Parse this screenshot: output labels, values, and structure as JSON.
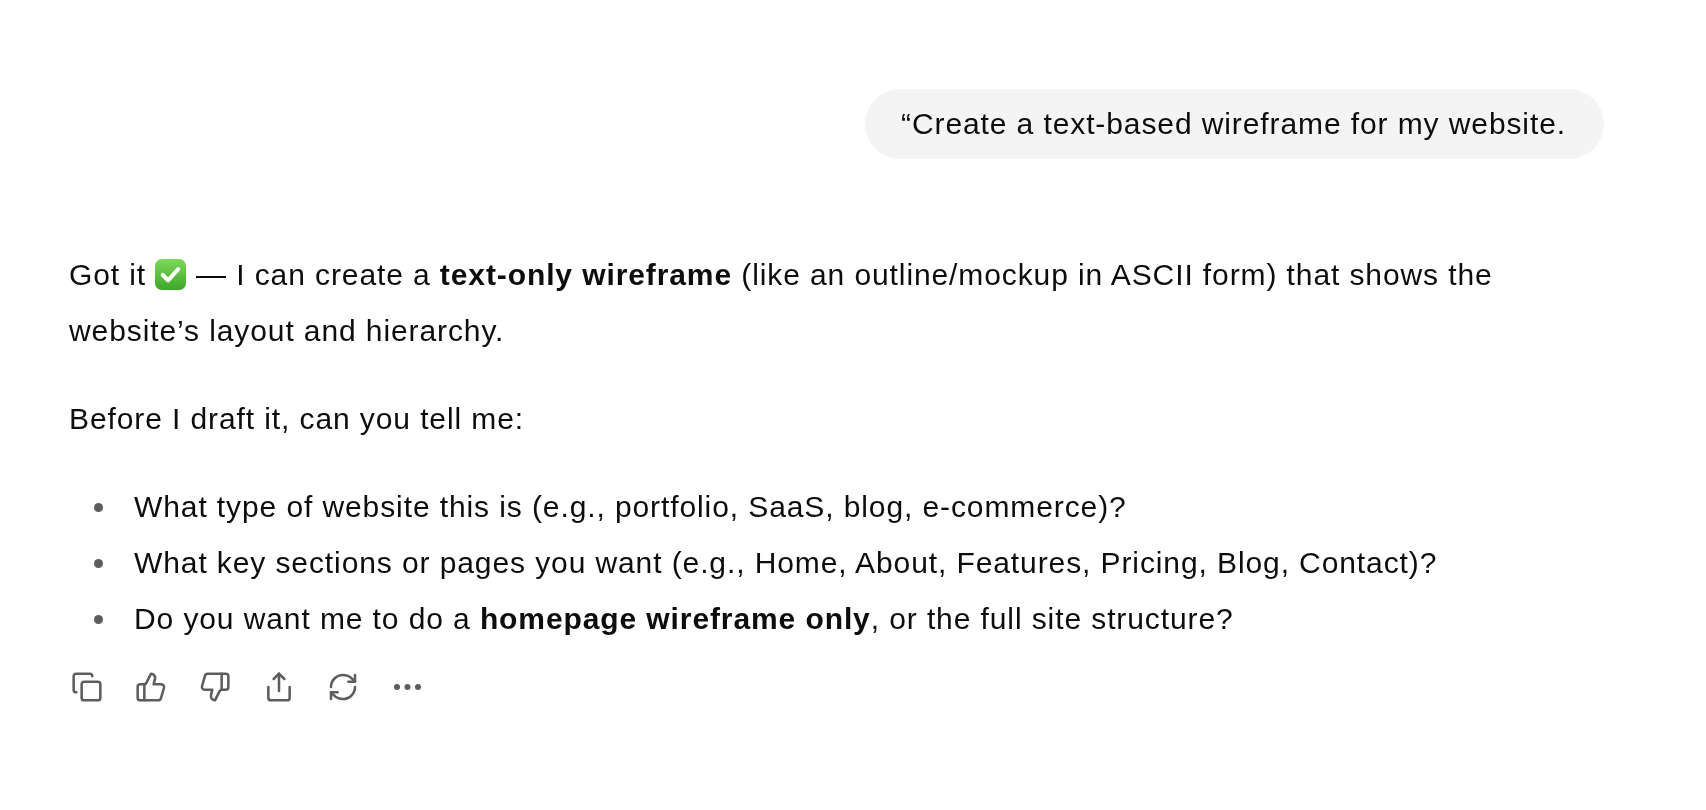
{
  "user_message": {
    "text": "“Create a text-based wireframe for my website."
  },
  "assistant_message": {
    "paragraphs": [
      {
        "segments": [
          {
            "kind": "text",
            "text": "Got it"
          },
          {
            "kind": "check_emoji"
          },
          {
            "kind": "text",
            "text": "— I can create a **text-only wireframe** (like an outline/mockup in ASCII form) that shows the website’s layout and hierarchy."
          }
        ]
      },
      {
        "segments": [
          {
            "kind": "text",
            "text": "Before I draft it, can you tell me:"
          }
        ]
      }
    ],
    "bullets": [
      "What type of website this is (e.g., portfolio, SaaS, blog, e-commerce)?",
      "What key sections or pages you want (e.g., Home, About, Features, Pricing, Blog, Contact)?",
      "Do you want me to do a **homepage wireframe only**, or the full site structure?"
    ]
  },
  "actions": [
    {
      "kind": "copy"
    },
    {
      "kind": "thumbs_up"
    },
    {
      "kind": "thumbs_down"
    },
    {
      "kind": "share"
    },
    {
      "kind": "regenerate"
    },
    {
      "kind": "more"
    }
  ]
}
